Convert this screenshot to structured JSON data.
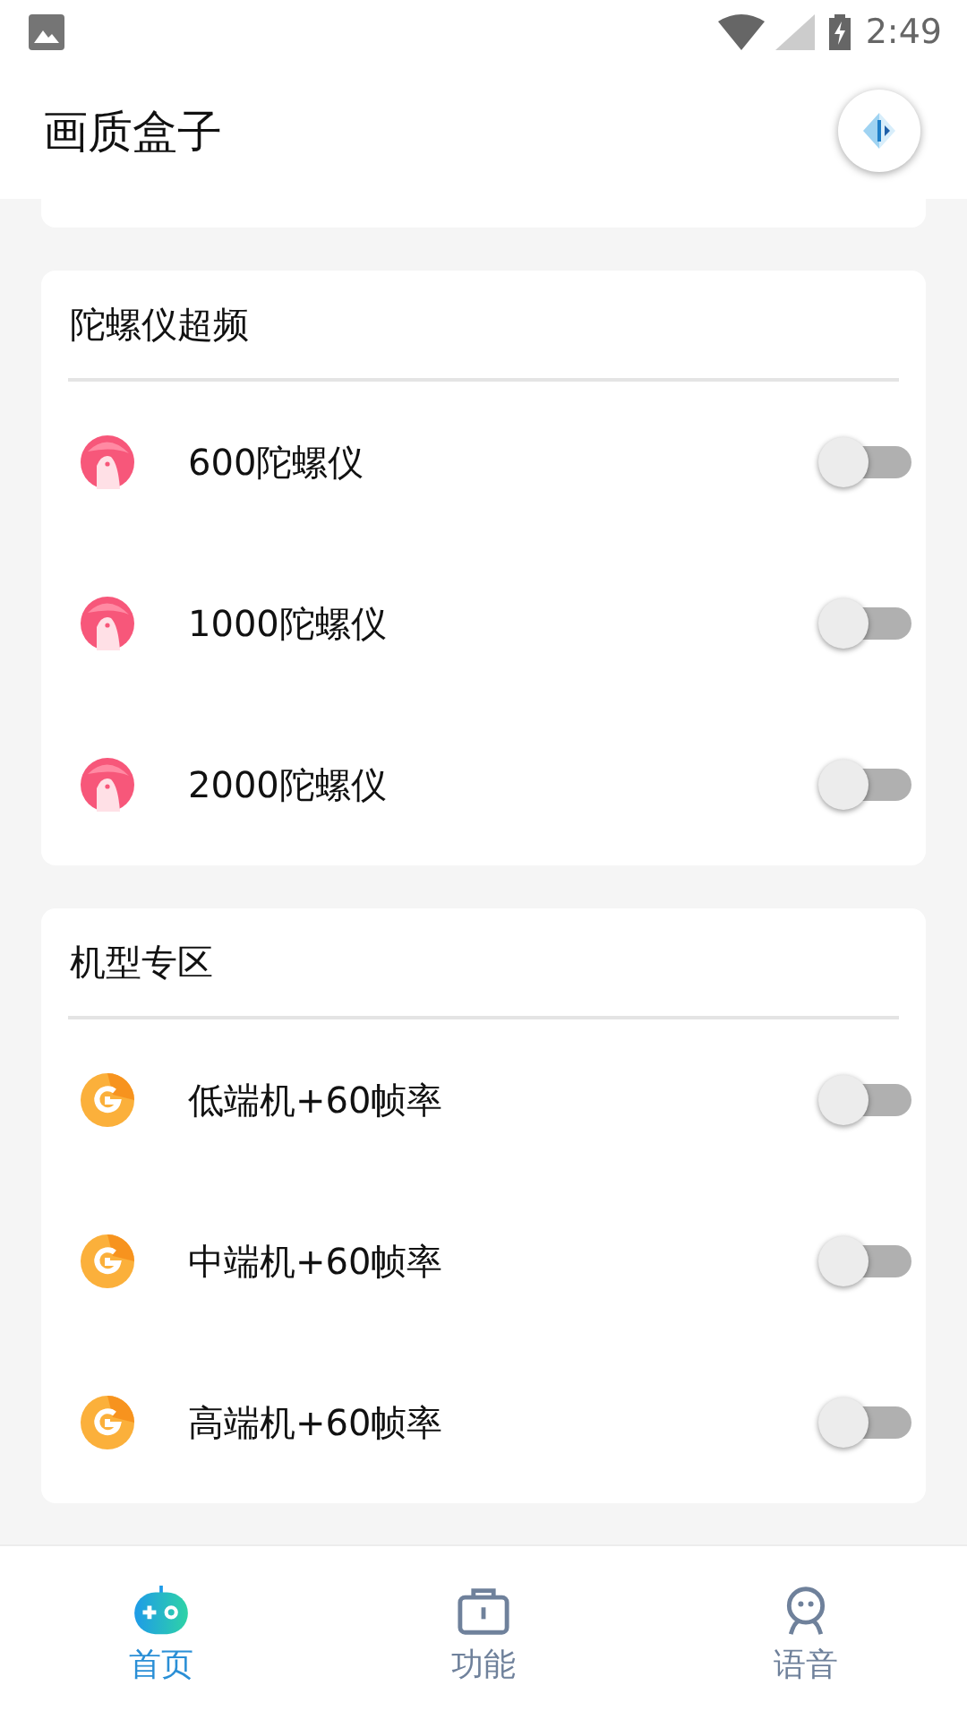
{
  "status_bar": {
    "time": "2:49"
  },
  "app_bar": {
    "title": "画质盒子"
  },
  "sections": [
    {
      "title": "陀螺仪超频",
      "kind": "gyro",
      "items": [
        {
          "label": "600陀螺仪",
          "on": false
        },
        {
          "label": "1000陀螺仪",
          "on": false
        },
        {
          "label": "2000陀螺仪",
          "on": false
        }
      ]
    },
    {
      "title": "机型专区",
      "kind": "model",
      "items": [
        {
          "label": "低端机+60帧率",
          "on": false
        },
        {
          "label": "中端机+60帧率",
          "on": false
        },
        {
          "label": "高端机+60帧率",
          "on": false
        }
      ]
    }
  ],
  "bottom_nav": [
    {
      "label": "首页",
      "kind": "home",
      "selected": true
    },
    {
      "label": "功能",
      "kind": "tools",
      "selected": false
    },
    {
      "label": "语音",
      "kind": "voice",
      "selected": false
    }
  ]
}
